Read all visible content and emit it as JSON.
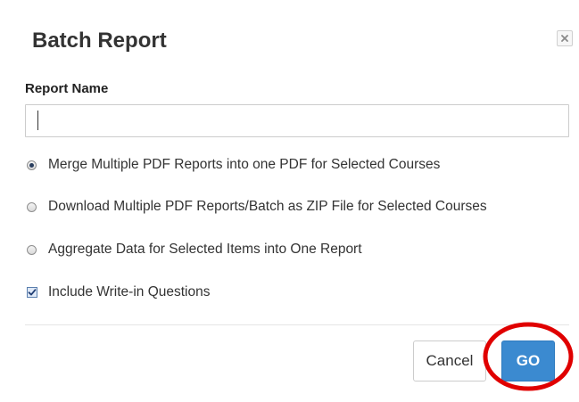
{
  "dialog": {
    "title": "Batch Report",
    "close_icon": "close-icon"
  },
  "report_name": {
    "label": "Report Name",
    "value": "",
    "placeholder": ""
  },
  "options": [
    {
      "label": "Merge Multiple PDF Reports into one PDF for Selected Courses",
      "selected": true
    },
    {
      "label": "Download Multiple PDF Reports/Batch as ZIP File for Selected Courses",
      "selected": false
    },
    {
      "label": "Aggregate Data for Selected Items into One Report",
      "selected": false
    }
  ],
  "include_write_in": {
    "label": "Include Write-in Questions",
    "checked": true
  },
  "footer": {
    "cancel_label": "Cancel",
    "go_label": "GO"
  },
  "colors": {
    "go_button": "#3b8ad0",
    "highlight_circle": "#e00000"
  }
}
